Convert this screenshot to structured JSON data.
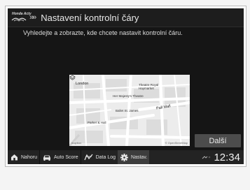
{
  "header": {
    "brand": "Honda Acty",
    "chevrons": "»»",
    "title": "Nastavení kontrolní čáry"
  },
  "subtitle": "Vyhledejte a zobrazte, kde chcete nastavit kontrolní čáru.",
  "map": {
    "labels": {
      "london": "London",
      "theatre_royal": "Theatre Royal Haymarket",
      "her_majestys": "Her Majesty's Theatre",
      "st_james": "Ballet St. James",
      "pall_mall": "Pall Mall",
      "parker": "Parker & Hall"
    },
    "brand": "mapbox",
    "credit": "© OpenStreetMap"
  },
  "next_button": "Další",
  "nav": {
    "items": [
      {
        "label": "Nahoru",
        "icon": "home-icon"
      },
      {
        "label": "Auto Score",
        "icon": "car-icon"
      },
      {
        "label": "Data Log",
        "icon": "route-icon"
      },
      {
        "label": "Nastav.",
        "icon": "gear-icon",
        "active": true
      }
    ],
    "status_icon": "signal-icon",
    "clock": "12:34"
  }
}
